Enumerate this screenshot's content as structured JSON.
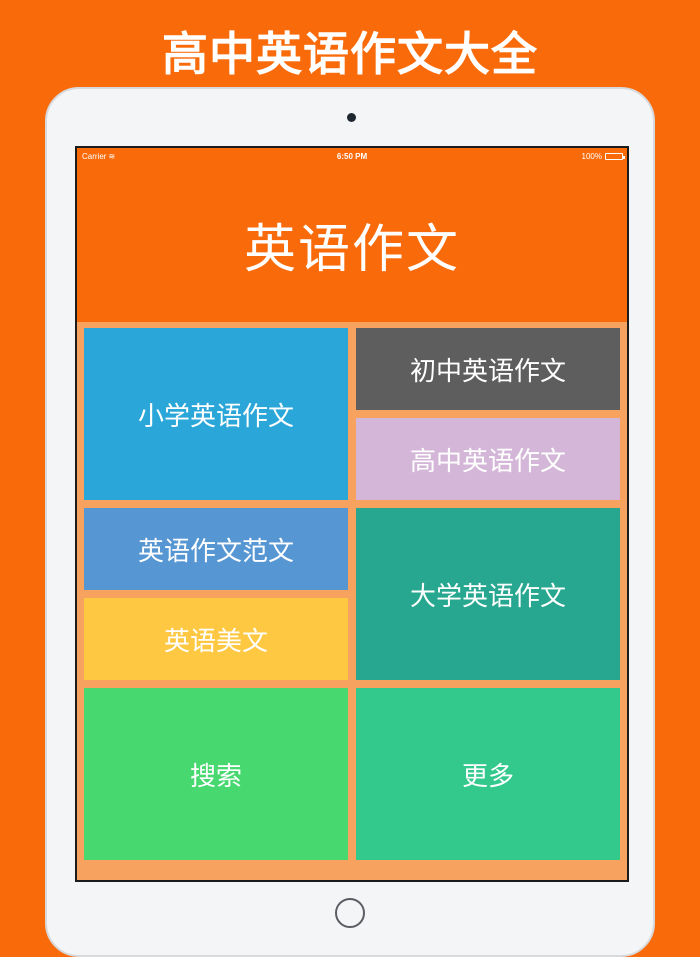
{
  "promo": {
    "title": "高中英语作文大全"
  },
  "status_bar": {
    "carrier": "Carrier",
    "time": "6:50 PM",
    "battery": "100%"
  },
  "header": {
    "title": "英语作文"
  },
  "tiles": [
    {
      "label": "小学英语作文",
      "color": "#2ba6d8"
    },
    {
      "label": "初中英语作文",
      "color": "#5e5e5e"
    },
    {
      "label": "高中英语作文",
      "color": "#d4b7d8"
    },
    {
      "label": "英语作文范文",
      "color": "#5696d2"
    },
    {
      "label": "大学英语作文",
      "color": "#27a78f"
    },
    {
      "label": "英语美文",
      "color": "#fec843"
    },
    {
      "label": "搜索",
      "color": "#48d870"
    },
    {
      "label": "更多",
      "color": "#33c98c"
    }
  ],
  "colors": {
    "brand": "#f96b0a",
    "grid_background": "#f7a25e"
  }
}
